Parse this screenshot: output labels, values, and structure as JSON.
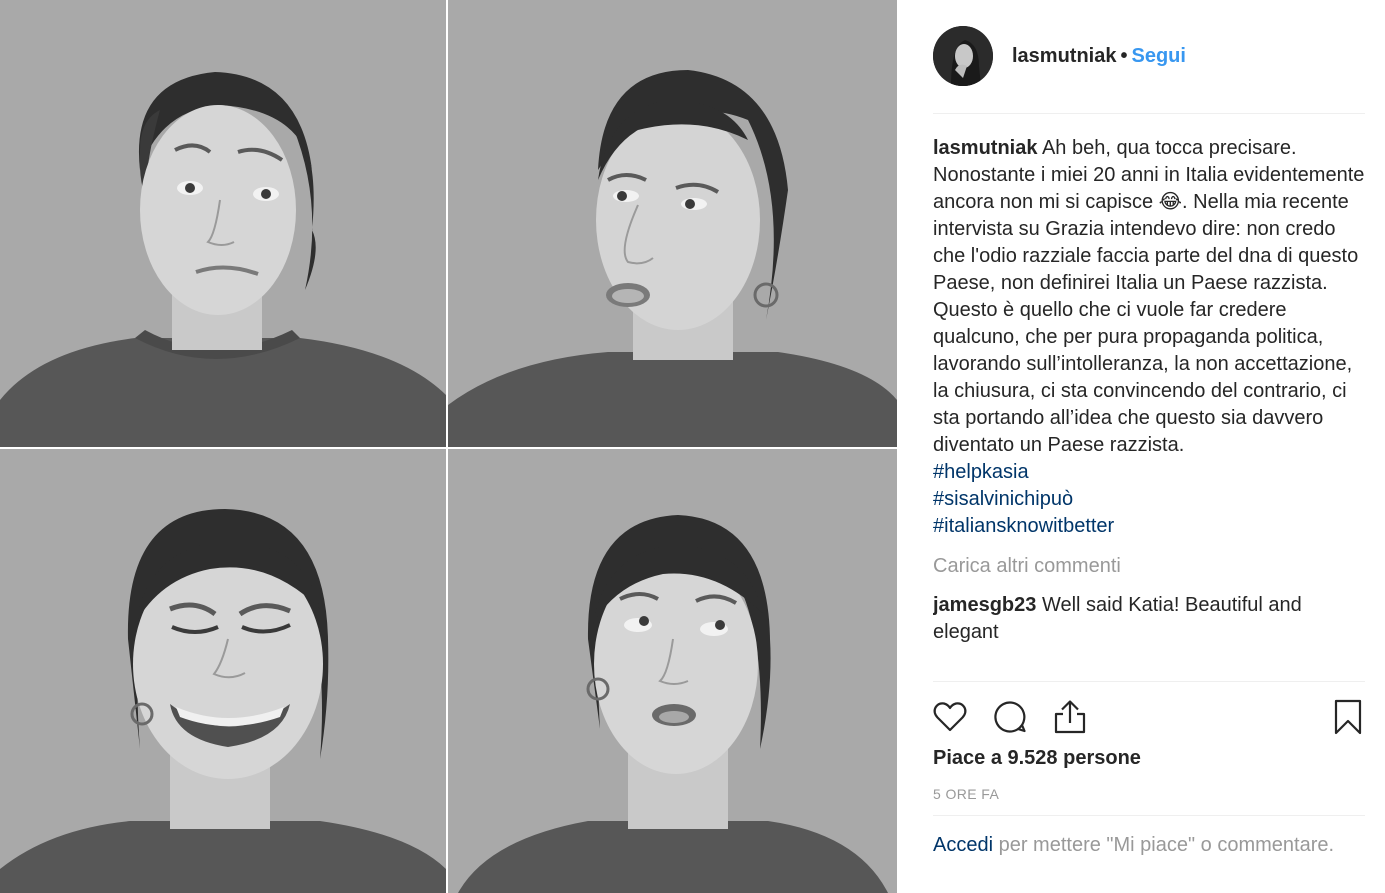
{
  "post": {
    "username": "lasmutniak",
    "separator": "•",
    "follow_label": "Segui",
    "caption_user": "lasmutniak",
    "caption_text": "Ah beh, qua tocca precisare. Nonostante i miei 20 anni in Italia evidentemente ancora non mi si capisce 😂. Nella mia recente intervista su Grazia intendevo dire: non credo che l'odio razziale faccia parte del dna di questo Paese, non definirei Italia un Paese razzista. Questo è quello che ci vuole far credere qualcuno, che per pura propaganda politica, lavorando sull’intolleranza, la non accettazione, la chiusura, ci sta convincendo del contrario, ci sta portando all’idea che questo sia davvero diventato un Paese razzista.",
    "hashtags": [
      "#helpkasia",
      "#sisalvinichipuò",
      "#italiansknowitbetter"
    ],
    "load_more": "Carica altri commenti",
    "comments": [
      {
        "user": "jamesgb23",
        "text": "Well said Katia! Beautiful and elegant"
      }
    ],
    "likes": "Piace a 9.528 persone",
    "time": "5 ORE FA",
    "login_link": "Accedi",
    "login_text": " per mettere \"Mi piace\" o commentare."
  },
  "icons": {
    "like": "heart-icon",
    "comment": "speech-bubble-icon",
    "share": "share-icon",
    "save": "bookmark-icon"
  },
  "colors": {
    "link_blue": "#3897f0",
    "hashtag": "#003569",
    "muted": "#999999",
    "text": "#262626"
  }
}
